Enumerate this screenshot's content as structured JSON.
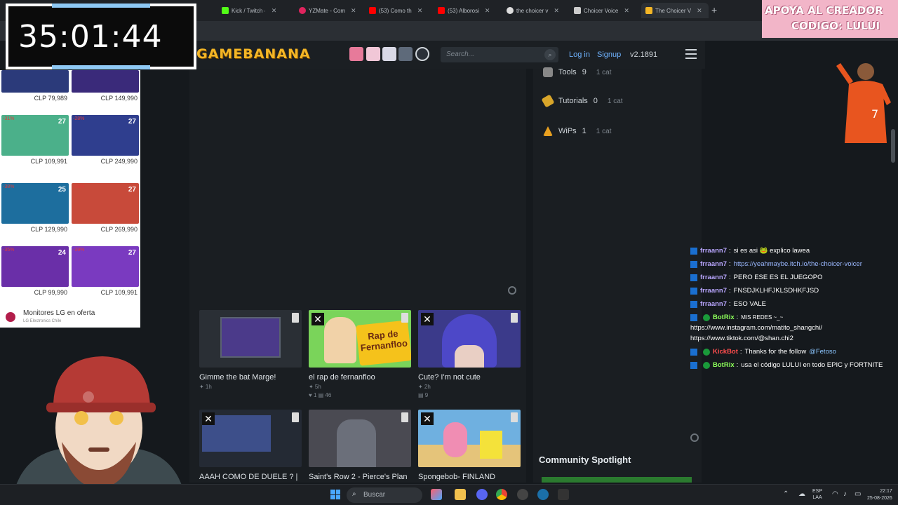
{
  "browser": {
    "tabs": [
      {
        "label": "Kick / Twitch ∙",
        "color": "#53fc18"
      },
      {
        "label": "YZMate - Com",
        "color": "#e0245e"
      },
      {
        "label": "(53) Como th",
        "color": "#ff0000"
      },
      {
        "label": "(53) Alborosi",
        "color": "#ff0000"
      },
      {
        "label": "the choicer v",
        "color": "#dddddd"
      },
      {
        "label": "Choicer Voice",
        "color": "#cccccc"
      },
      {
        "label": "The Choicer V",
        "color": "#f4b626"
      }
    ],
    "new_tab": "+"
  },
  "site": {
    "logo": "GAMEBANANA",
    "search_placeholder": "Search...",
    "login": "Log in",
    "signup": "Signup",
    "version": "v2.1891"
  },
  "categories": [
    {
      "name": "Tools",
      "count": "9",
      "sub": "1 cat",
      "color": "#888888"
    },
    {
      "name": "Tutorials",
      "count": "0",
      "sub": "1 cat",
      "color": "#d9a62a"
    },
    {
      "name": "WiPs",
      "count": "1",
      "sub": "1 cat",
      "color": "#e8a020"
    }
  ],
  "spotlight_title": "Community Spotlight",
  "cards": [
    {
      "title": "Gimme the bat Marge!",
      "meta": "✦  1h",
      "color": "#2a2f35"
    },
    {
      "title": "el rap de fernanfloo",
      "meta": "✦  5h",
      "stats": "♥ 1  ▤ 46",
      "color": "#7ad45a",
      "badge": "Rap de Fernanfloo"
    },
    {
      "title": "Cute? I'm not cute",
      "meta": "✦  2h",
      "stats": "▤ 9",
      "color": "#3b3a8a"
    },
    {
      "title": "AAAH COMO DE DUELE ? |",
      "meta": "",
      "color": "#3d4f8a"
    },
    {
      "title": "Saint's Row 2 - Pierce's Plan",
      "meta": "",
      "color": "#4a4a52"
    },
    {
      "title": "Spongebob- FINLAND",
      "meta": "",
      "color": "#e08ab0"
    }
  ],
  "timer": "35:01:44",
  "ad": {
    "items": [
      {
        "disc": "",
        "size": "",
        "price": "CLP 79,989",
        "color": "#2b3a7a"
      },
      {
        "disc": "",
        "size": "",
        "price": "CLP 149,990",
        "color": "#3a2a7a"
      },
      {
        "disc": "-31%",
        "size": "27",
        "price": "CLP 109,991",
        "color": "#4bb08a"
      },
      {
        "disc": "-28%",
        "size": "27",
        "price": "CLP 249,990",
        "color": "#2f3e8e"
      },
      {
        "disc": "-38%",
        "size": "25",
        "price": "CLP 129,990",
        "color": "#1d6e9e"
      },
      {
        "disc": "-28%",
        "size": "27",
        "price": "CLP 269,990",
        "color": "#c84a3a"
      },
      {
        "disc": "-35%",
        "size": "24",
        "price": "CLP 99,990",
        "color": "#6a2fa8"
      },
      {
        "disc": "-39%",
        "size": "27",
        "price": "CLP 109,991",
        "color": "#7a3ac0"
      }
    ],
    "footer_title": "Monitores LG en oferta",
    "footer_sub": "LG Electronics Chile"
  },
  "creator": {
    "line1": "APOYA AL CREADOR",
    "line2": "CODIGO: LULUI"
  },
  "chat": [
    {
      "user": "frraann7",
      "color": "#b9a6ff",
      "text": "si es asi 🐸 explico lawea"
    },
    {
      "user": "frraann7",
      "color": "#b9a6ff",
      "link": "https://yeahmaybe.itch.io/the-choicer-voicer"
    },
    {
      "user": "frraann7",
      "color": "#b9a6ff",
      "text": "PERO ESE ES EL JUEGOPO"
    },
    {
      "user": "frraann7",
      "color": "#b9a6ff",
      "text": "FNSDJKLHFJKLSDHKFJSD"
    },
    {
      "user": "frraann7",
      "color": "#b9a6ff",
      "text": "ESO VALE"
    },
    {
      "user": "BotRix",
      "color": "#8cff5a",
      "text": "MIS REDES ~_~",
      "line2": "https://www.instagram.com/matito_shangchi/",
      "line3": "https://www.tiktok.com/@shan.chi2"
    },
    {
      "user": "KickBot",
      "color": "#ff4d4d",
      "text": "Thanks for the follow",
      "mention": "@Fetoso"
    },
    {
      "user": "BotRix",
      "color": "#8cff5a",
      "text": "usa el código LULUI en todo EPIC y FORTNITE"
    }
  ],
  "taskbar": {
    "search": "Buscar",
    "lang1": "ESP",
    "lang2": "LAA",
    "time": "22:17",
    "date": "25-08-2026"
  }
}
